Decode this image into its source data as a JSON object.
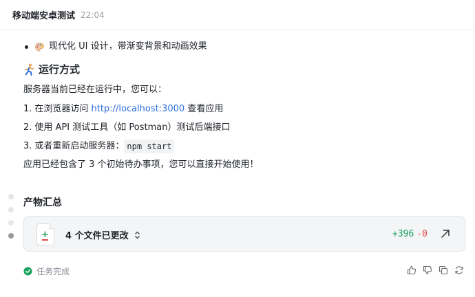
{
  "header": {
    "title": "移动端安卓测试",
    "time": "22:04"
  },
  "message": {
    "bullet_text": "现代化 UI 设计，带渐变背景和动画效果",
    "section_heading": "运行方式",
    "intro": "服务器当前已经在运行中，您可以：",
    "steps": [
      {
        "num": "1.",
        "prefix": "在浏览器访问 ",
        "link": "http://localhost:3000",
        "suffix": " 查看应用"
      },
      {
        "num": "2.",
        "text": "使用 API 测试工具（如 Postman）测试后端接口"
      },
      {
        "num": "3.",
        "prefix": "或者重新启动服务器：",
        "code": "npm start"
      }
    ],
    "closing": "应用已经包含了 3 个初始待办事项，您可以直接开始使用！"
  },
  "artifacts": {
    "title": "产物汇总",
    "files_changed": "4 个文件已更改",
    "additions": "+396",
    "deletions": "-0"
  },
  "status": {
    "label": "任务完成"
  },
  "colors": {
    "link": "#2f6fdb",
    "additions": "#1aa260",
    "deletions": "#e04848",
    "success": "#1aa260"
  },
  "icons": [
    "palette-icon",
    "runner-icon",
    "file-diff-icon",
    "chevron-updown-icon",
    "open-external-icon",
    "check-circle-icon",
    "thumbs-up-icon",
    "thumbs-down-icon",
    "copy-icon",
    "refresh-icon"
  ]
}
